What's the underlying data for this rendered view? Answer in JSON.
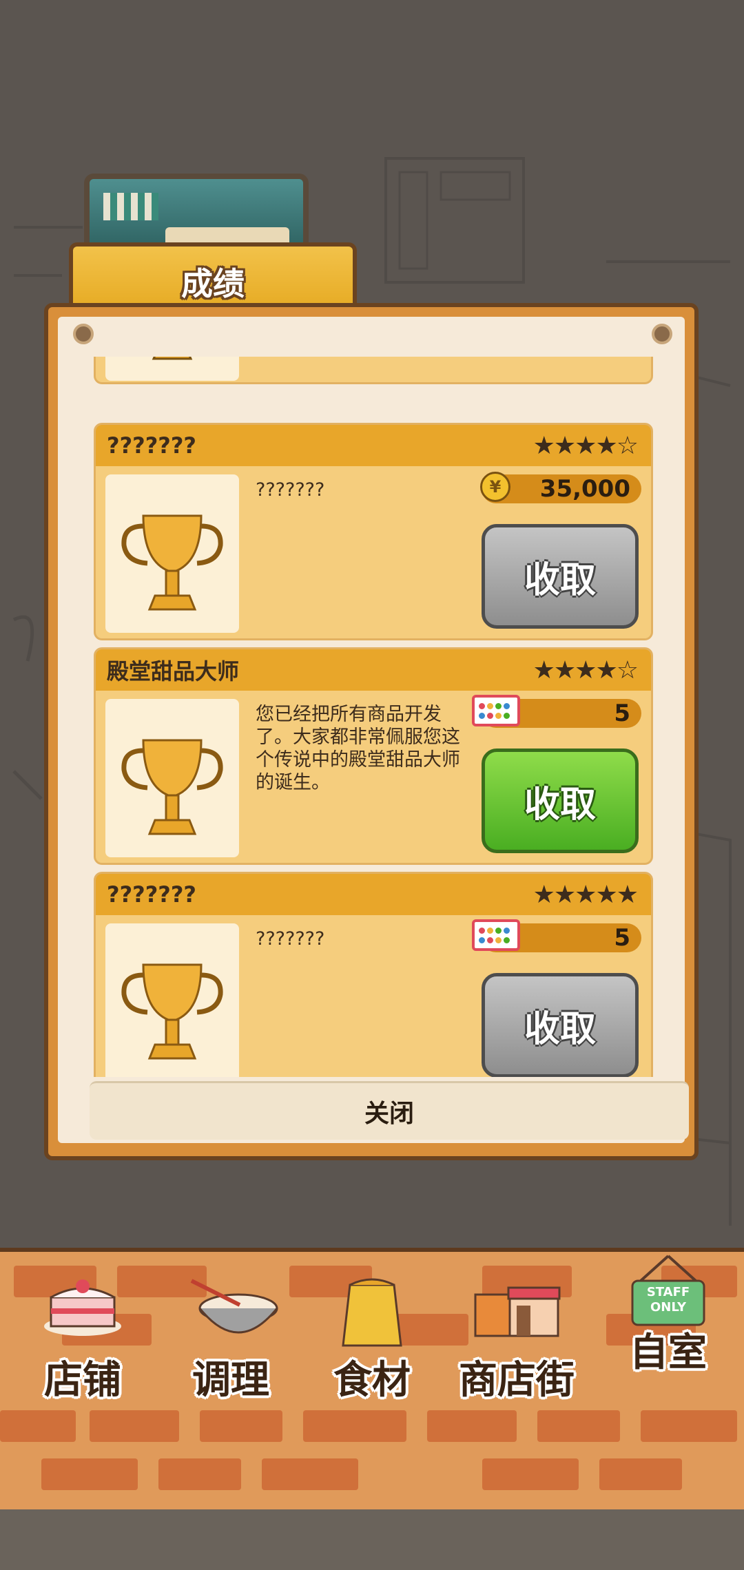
{
  "header": {
    "tab_title": "成绩"
  },
  "achievements": [
    {
      "title": "???????",
      "stars": "★★★★☆",
      "description": "???????",
      "reward_type": "coin",
      "reward_value": "35,000",
      "button": "收取",
      "button_state": "disabled"
    },
    {
      "title": "殿堂甜品大师",
      "stars": "★★★★☆",
      "description": "您已经把所有商品开发了。大家都非常佩服您这个传说中的殿堂甜品大师的诞生。",
      "reward_type": "ticket",
      "reward_value": "5",
      "button": "收取",
      "button_state": "enabled"
    },
    {
      "title": "???????",
      "stars": "★★★★★",
      "description": "???????",
      "reward_type": "ticket",
      "reward_value": "5",
      "button": "收取",
      "button_state": "disabled"
    }
  ],
  "close_label": "关闭",
  "nav": [
    {
      "label": "店铺",
      "icon": "cake-icon"
    },
    {
      "label": "调理",
      "icon": "mixing-bowl-icon"
    },
    {
      "label": "食材",
      "icon": "flour-bag-icon"
    },
    {
      "label": "商店街",
      "icon": "storefront-icon"
    },
    {
      "label": "自室",
      "icon": "staff-only-sign-icon"
    }
  ],
  "staff_sign_text": "STAFF ONLY",
  "colors": {
    "accent": "#e8a62a",
    "button_green": "#4aae22",
    "button_gray": "#9a9a9a",
    "brick": "#d0703a"
  }
}
